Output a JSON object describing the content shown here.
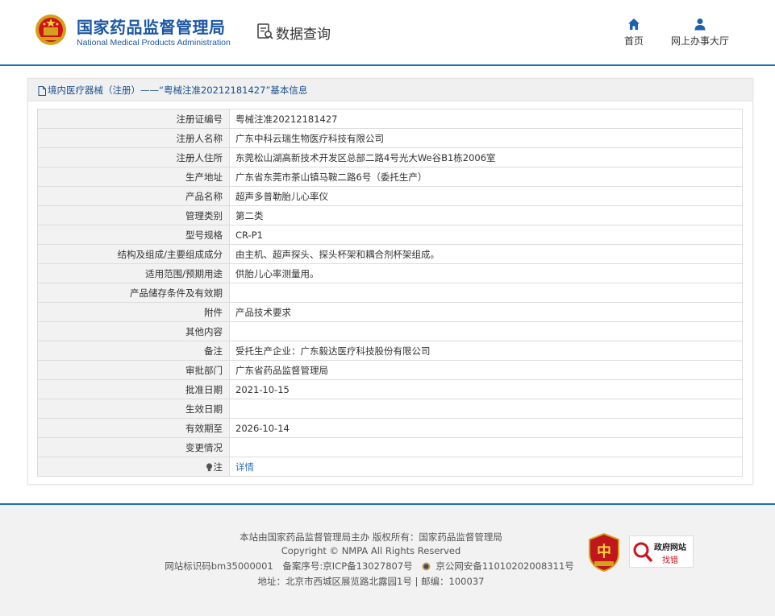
{
  "header": {
    "site_name_cn": "国家药品监督管理局",
    "site_name_en": "National Medical Products Administration",
    "query_label": "数据查询",
    "nav": [
      {
        "label": "首页",
        "icon": "home-icon"
      },
      {
        "label": "网上办事大厅",
        "icon": "user-icon"
      }
    ]
  },
  "panel": {
    "title": "境内医疗器械（注册）——“粤械注准20212181427”基本信息",
    "rows": [
      {
        "label": "注册证编号",
        "value": "粤械注准20212181427"
      },
      {
        "label": "注册人名称",
        "value": "广东中科云瑞生物医疗科技有限公司"
      },
      {
        "label": "注册人住所",
        "value": "东莞松山湖高新技术开发区总部二路4号光大We谷B1栋2006室"
      },
      {
        "label": "生产地址",
        "value": "广东省东莞市茶山镇马鞍二路6号（委托生产）"
      },
      {
        "label": "产品名称",
        "value": "超声多普勒胎儿心率仪"
      },
      {
        "label": "管理类别",
        "value": "第二类"
      },
      {
        "label": "型号规格",
        "value": "CR-P1"
      },
      {
        "label": "结构及组成/主要组成成分",
        "value": "由主机、超声探头、探头杯架和耦合剂杯架组成。"
      },
      {
        "label": "适用范围/预期用途",
        "value": "供胎儿心率测量用。"
      },
      {
        "label": "产品储存条件及有效期",
        "value": ""
      },
      {
        "label": "附件",
        "value": "产品技术要求"
      },
      {
        "label": "其他内容",
        "value": ""
      },
      {
        "label": "备注",
        "value": "受托生产企业：广东毅达医疗科技股份有限公司"
      },
      {
        "label": "审批部门",
        "value": "广东省药品监督管理局"
      },
      {
        "label": "批准日期",
        "value": "2021-10-15"
      },
      {
        "label": "生效日期",
        "value": ""
      },
      {
        "label": "有效期至",
        "value": "2026-10-14"
      },
      {
        "label": "变更情况",
        "value": ""
      }
    ],
    "note_label": "注",
    "note_link": "详情"
  },
  "footer": {
    "line1": "本站由国家药品监督管理局主办 版权所有：国家药品监督管理局",
    "line2": "Copyright © NMPA All Rights Reserved",
    "site_id": "网站标识码bm35000001",
    "icp": "备案序号:京ICP备13027807号",
    "police": "京公网安备11010202008311号",
    "address": "地址：北京市西城区展览路北露园1号 | 邮编：100037",
    "gov_badge_line1": "政府网站",
    "gov_badge_line2": "找错"
  },
  "colors": {
    "brand_blue": "#1c58a5",
    "header_rule": "#1f6fb8",
    "link": "#2a6fc9",
    "label_bg": "#f2f2f2"
  }
}
